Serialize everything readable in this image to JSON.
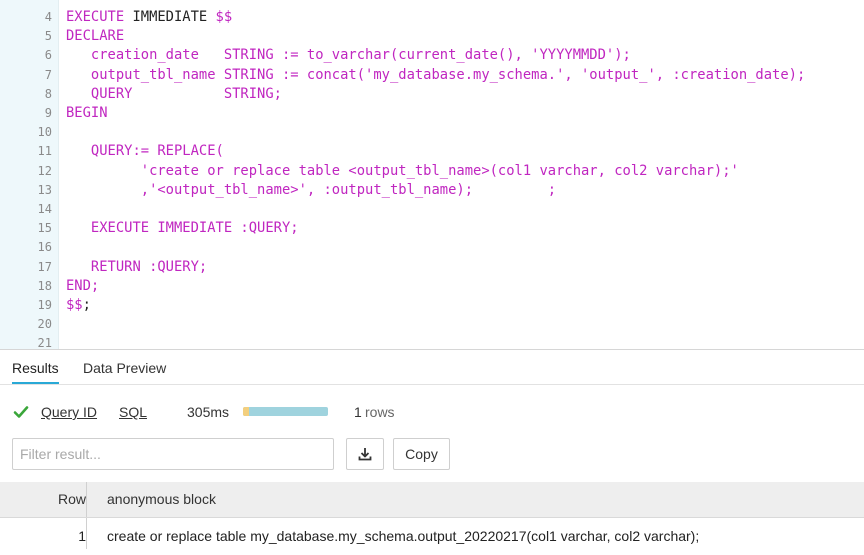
{
  "editor": {
    "lines": [
      {
        "num": "4",
        "parts": [
          {
            "t": "EXECUTE ",
            "c": "kw"
          },
          {
            "t": "IMMEDIATE",
            "c": "plain"
          },
          {
            "t": " $$",
            "c": "kw"
          }
        ]
      },
      {
        "num": "5",
        "parts": [
          {
            "t": "DECLARE",
            "c": "kw"
          }
        ]
      },
      {
        "num": "6",
        "parts": [
          {
            "t": "   creation_date   STRING := to_varchar(current_date(), 'YYYYMMDD');",
            "c": "kw"
          }
        ]
      },
      {
        "num": "7",
        "parts": [
          {
            "t": "   output_tbl_name STRING := concat('my_database.my_schema.', 'output_', :creation_date);",
            "c": "kw"
          }
        ]
      },
      {
        "num": "8",
        "parts": [
          {
            "t": "   QUERY           STRING;",
            "c": "kw"
          }
        ]
      },
      {
        "num": "9",
        "parts": [
          {
            "t": "BEGIN",
            "c": "kw"
          }
        ]
      },
      {
        "num": "10",
        "parts": [
          {
            "t": "",
            "c": "kw"
          }
        ]
      },
      {
        "num": "11",
        "parts": [
          {
            "t": "   QUERY:= REPLACE(",
            "c": "kw"
          }
        ]
      },
      {
        "num": "12",
        "parts": [
          {
            "t": "         'create or replace table <output_tbl_name>(col1 varchar, col2 varchar);'",
            "c": "kw"
          }
        ]
      },
      {
        "num": "13",
        "parts": [
          {
            "t": "         ,'<output_tbl_name>', :output_tbl_name);         ;",
            "c": "kw"
          }
        ]
      },
      {
        "num": "14",
        "parts": [
          {
            "t": "",
            "c": "kw"
          }
        ]
      },
      {
        "num": "15",
        "parts": [
          {
            "t": "   EXECUTE IMMEDIATE :QUERY;",
            "c": "kw"
          }
        ]
      },
      {
        "num": "16",
        "parts": [
          {
            "t": "",
            "c": "kw"
          }
        ]
      },
      {
        "num": "17",
        "parts": [
          {
            "t": "   RETURN :QUERY;",
            "c": "kw"
          }
        ]
      },
      {
        "num": "18",
        "parts": [
          {
            "t": "END;",
            "c": "kw"
          }
        ]
      },
      {
        "num": "19",
        "parts": [
          {
            "t": "$$",
            "c": "kw"
          },
          {
            "t": ";",
            "c": "plain"
          }
        ]
      },
      {
        "num": "20",
        "parts": [
          {
            "t": "",
            "c": "kw"
          }
        ]
      },
      {
        "num": "21",
        "parts": [
          {
            "t": "",
            "c": "kw"
          }
        ]
      }
    ]
  },
  "tabs": {
    "results": "Results",
    "data_preview": "Data Preview"
  },
  "meta": {
    "query_id": "Query ID",
    "sql": "SQL",
    "duration": "305ms",
    "rows_count": "1",
    "rows_label": "rows"
  },
  "toolbar": {
    "filter_placeholder": "Filter result...",
    "download_icon": "download-icon",
    "copy_label": "Copy"
  },
  "table": {
    "headers": [
      "Row",
      "anonymous block"
    ],
    "rows": [
      {
        "row": "1",
        "value": "create or replace table my_database.my_schema.output_20220217(col1 varchar, col2 varchar);"
      }
    ]
  },
  "colors": {
    "keyword": "#c026c0",
    "gutter_bg": "#eef8fb",
    "accent": "#29a9d6",
    "success": "#3aa63a"
  }
}
